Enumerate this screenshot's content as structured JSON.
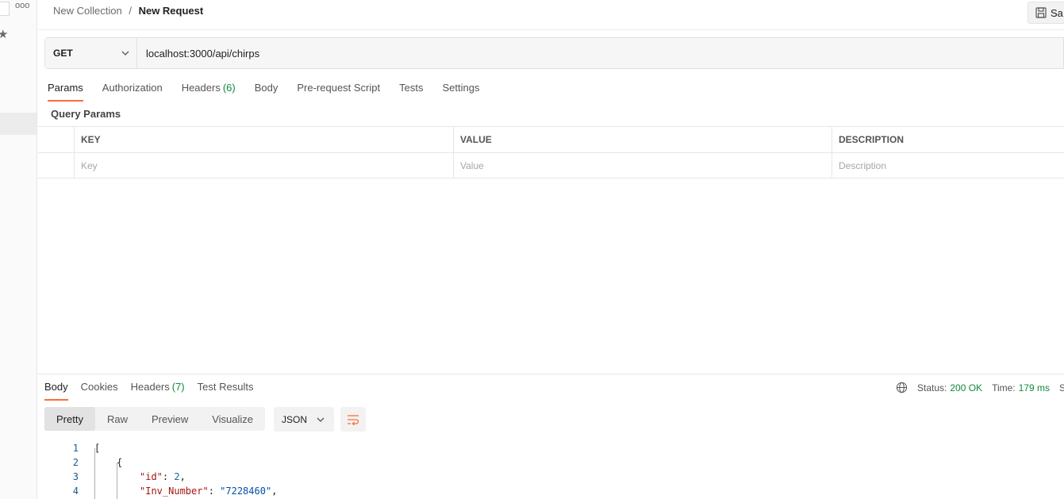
{
  "left_strip": {
    "dots": "ooo"
  },
  "header": {
    "breadcrumb_parent": "New Collection",
    "breadcrumb_sep": "/",
    "breadcrumb_current": "New Request",
    "save_label": "Sa"
  },
  "request": {
    "method": "GET",
    "url": "localhost:3000/api/chirps"
  },
  "request_tabs": [
    {
      "label": "Params",
      "count": ""
    },
    {
      "label": "Authorization",
      "count": ""
    },
    {
      "label": "Headers",
      "count": "(6)"
    },
    {
      "label": "Body",
      "count": ""
    },
    {
      "label": "Pre-request Script",
      "count": ""
    },
    {
      "label": "Tests",
      "count": ""
    },
    {
      "label": "Settings",
      "count": ""
    }
  ],
  "active_request_tab": "Params",
  "params": {
    "section_label": "Query Params",
    "columns": [
      "KEY",
      "VALUE",
      "DESCRIPTION"
    ],
    "placeholders": {
      "key": "Key",
      "value": "Value",
      "description": "Description"
    }
  },
  "response": {
    "tabs": [
      {
        "label": "Body",
        "count": ""
      },
      {
        "label": "Cookies",
        "count": ""
      },
      {
        "label": "Headers",
        "count": "(7)"
      },
      {
        "label": "Test Results",
        "count": ""
      }
    ],
    "status_label": "Status:",
    "status_value": "200 OK",
    "time_label": "Time:",
    "time_value": "179 ms",
    "size_label": "Si",
    "format_tabs": [
      "Pretty",
      "Raw",
      "Preview",
      "Visualize"
    ],
    "active_format": "Pretty",
    "language": "JSON",
    "code_lines": [
      {
        "num": "1",
        "text": "["
      },
      {
        "num": "2",
        "text": "{"
      },
      {
        "num": "3",
        "key": "\"id\"",
        "value": "2",
        "value_type": "number"
      },
      {
        "num": "4",
        "key": "\"Inv_Number\"",
        "value": "\"7228460\"",
        "value_type": "string"
      }
    ]
  },
  "colors": {
    "accent": "#ff6c37",
    "success": "#0f8a3e",
    "json_key": "#a31515",
    "json_string": "#0451a5",
    "json_number": "#0b6e99"
  }
}
